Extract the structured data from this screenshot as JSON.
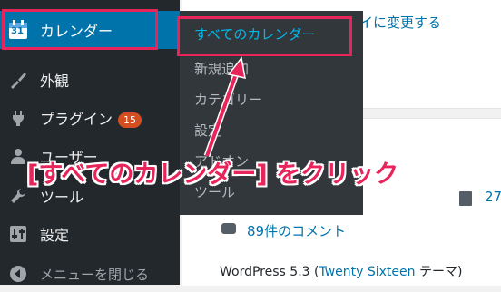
{
  "sidebar": {
    "items": [
      {
        "label": "カレンダー",
        "icon": "calendar-icon",
        "icon_text": "31"
      },
      {
        "label": "外観",
        "icon": "paintbrush-icon"
      },
      {
        "label": "プラグイン",
        "icon": "plugin-icon",
        "badge": "15"
      },
      {
        "label": "ユーザー",
        "icon": "user-icon"
      },
      {
        "label": "ツール",
        "icon": "wrench-icon"
      },
      {
        "label": "設定",
        "icon": "settings-icon"
      },
      {
        "label": "メニューを閉じる",
        "icon": "collapse-icon"
      }
    ]
  },
  "submenu": {
    "items": [
      "すべてのカレンダー",
      "新規追加",
      "カテゴリー",
      "設定",
      "アドオン",
      "ツール"
    ]
  },
  "content": {
    "top_link": "イに変更する",
    "comment_count_partial": "27",
    "comments_link": "89件のコメント",
    "wp_version_prefix": "WordPress 5.3 (",
    "theme_link": "Twenty Sixteen",
    "theme_suffix": " テーマ)"
  },
  "annotation": {
    "text": "[すべてのカレンダー] をクリック"
  },
  "colors": {
    "highlight": "#e8255a",
    "sidebar_bg": "#23282d",
    "submenu_bg": "#32373c",
    "active_bg": "#0073aa",
    "link": "#0073aa"
  }
}
